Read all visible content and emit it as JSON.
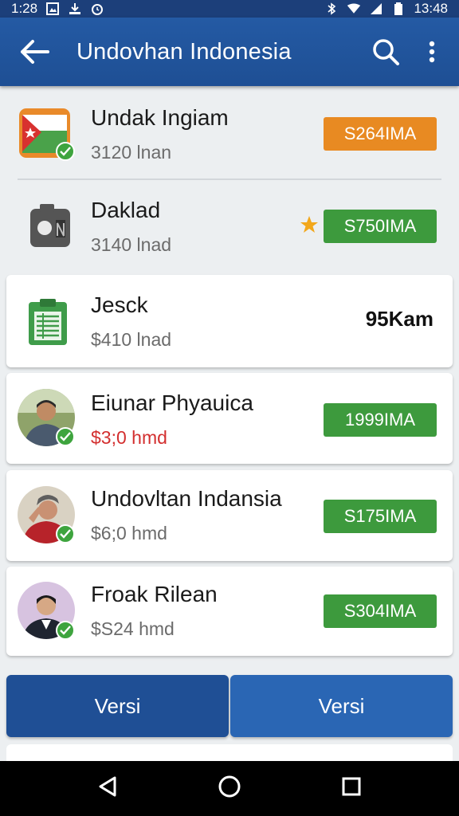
{
  "status_bar": {
    "time": "1:28",
    "clock": "13:48"
  },
  "app_bar": {
    "title": "Undovhan Indonesia"
  },
  "items": [
    {
      "name": "Undak Ingiam",
      "sub": "3120 lnan",
      "price": "S264IMA",
      "price_style": "orange",
      "icon": "flag-document-icon",
      "verified": true
    },
    {
      "name": "Daklad",
      "sub": "3140 lnad",
      "price": "S750IMA",
      "price_style": "green",
      "icon": "camera-icon",
      "verified": false,
      "starred": true
    },
    {
      "name": "Jesck",
      "sub": "$410 lnad",
      "price": "95Kam",
      "price_style": "plain",
      "icon": "spreadsheet-icon",
      "verified": false
    },
    {
      "name": "Eiunar Phyauica",
      "sub": "$3;0 hmd",
      "sub_style": "red",
      "price": "1999IMA",
      "price_style": "green",
      "icon": "avatar",
      "verified": true
    },
    {
      "name": "Undovltan Indansia",
      "sub": "$6;0 hmd",
      "price": "S175IMA",
      "price_style": "green",
      "icon": "avatar",
      "verified": true
    },
    {
      "name": "Froak Rilean",
      "sub": "$S24 hmd",
      "price": "S304IMA",
      "price_style": "green",
      "icon": "avatar",
      "verified": true
    }
  ],
  "tabs": [
    {
      "label": "Versi"
    },
    {
      "label": "Versi"
    }
  ],
  "colors": {
    "app_bar": "#1e4f94",
    "price_green": "#3d9a3d",
    "price_orange": "#e88a22",
    "verified": "#3ea43e"
  }
}
